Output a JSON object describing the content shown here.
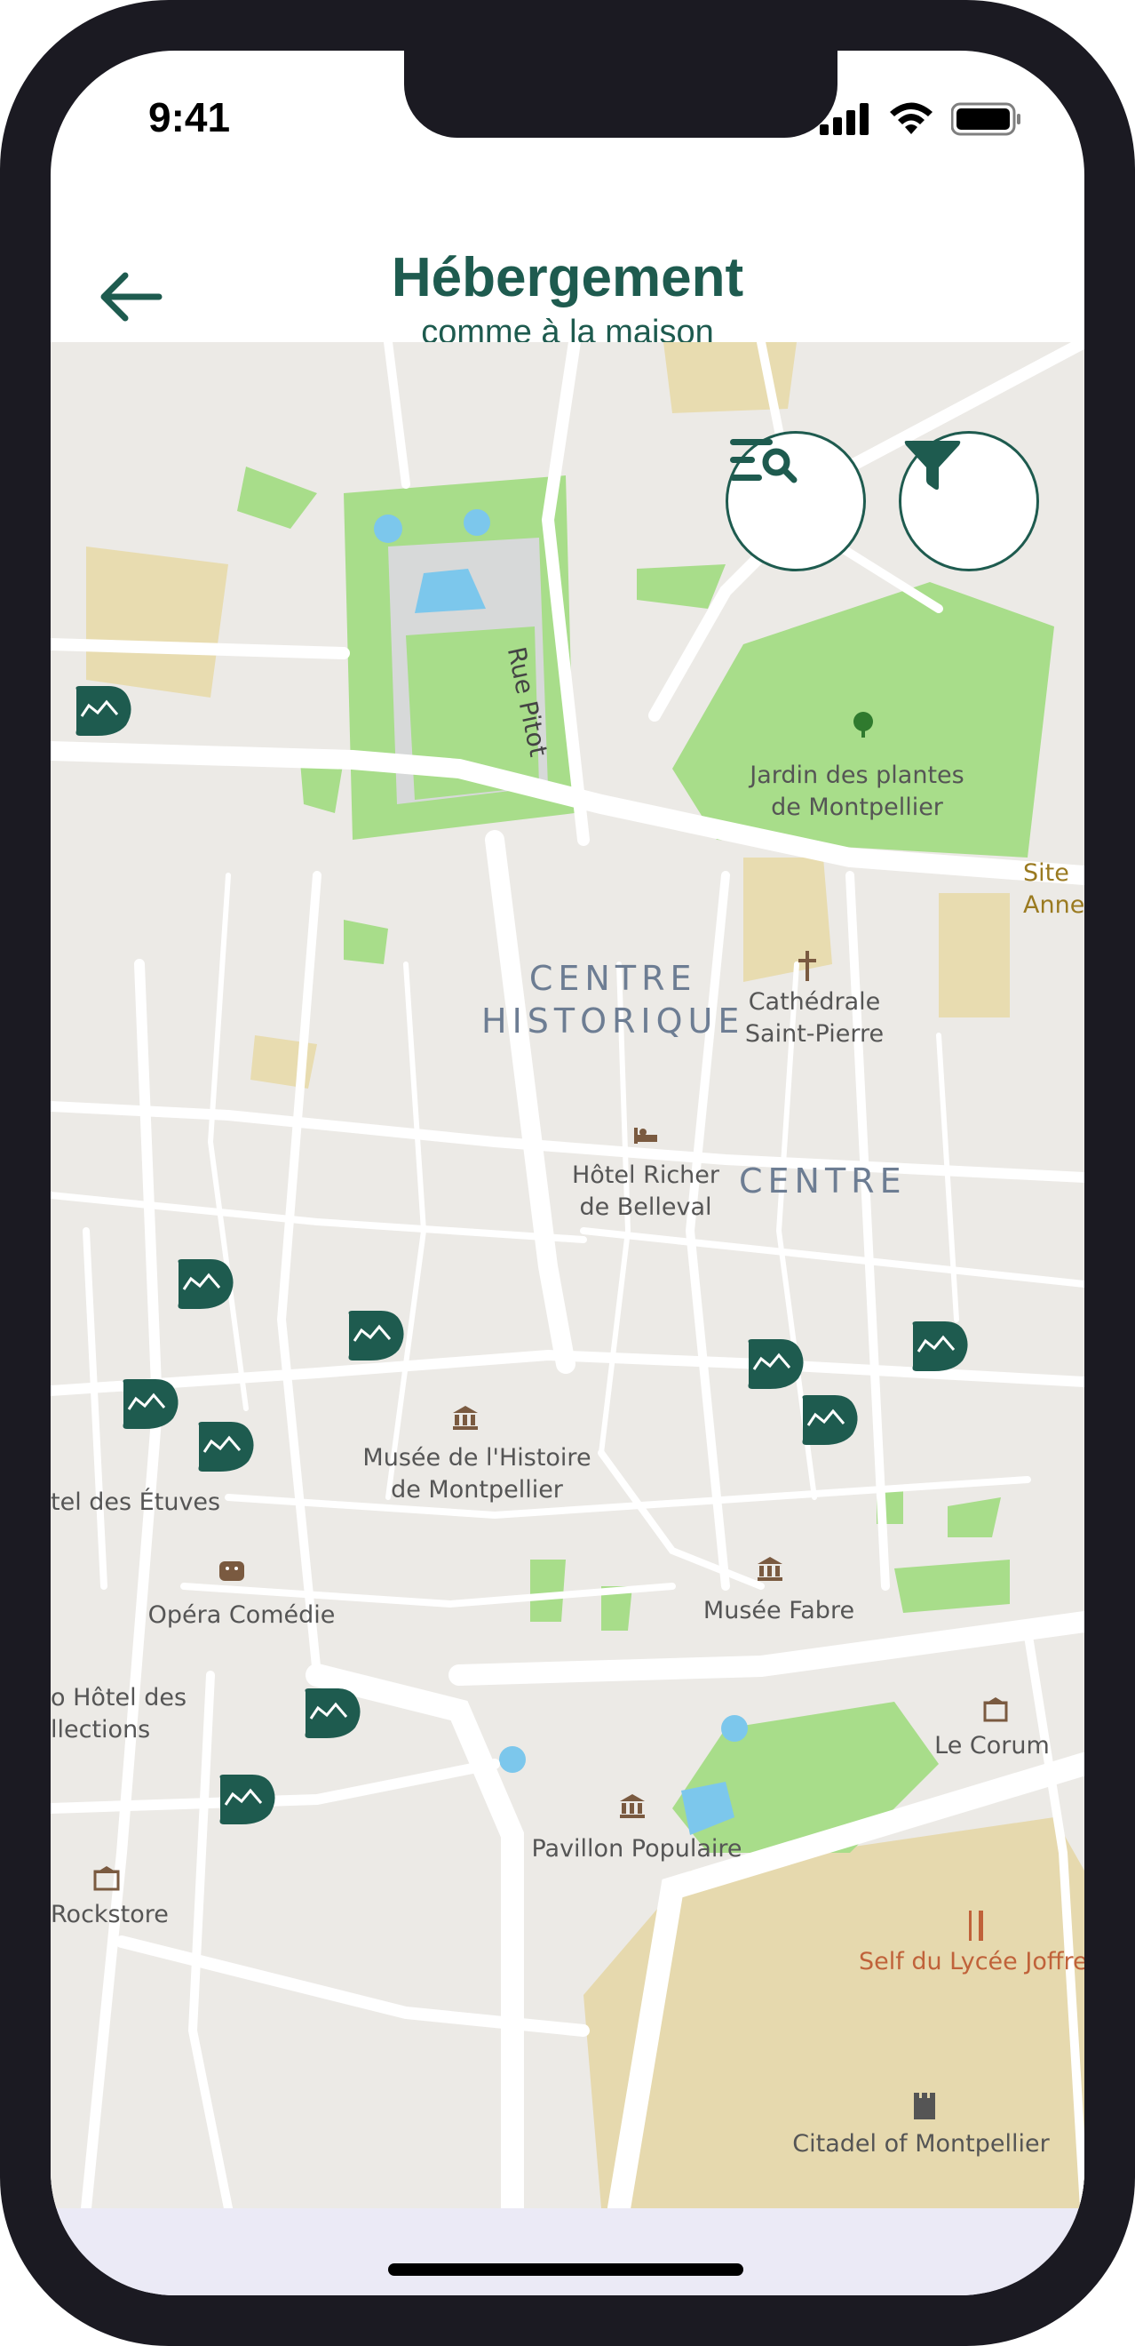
{
  "status": {
    "time": "9:41"
  },
  "header": {
    "title": "Hébergement",
    "subtitle": "comme à la maison"
  },
  "icons": {
    "back": "arrow-left-icon",
    "search_list": "list-search-icon",
    "filter": "filter-icon",
    "marker": "accommodation-marker-icon"
  },
  "colors": {
    "brand": "#1e5b4f",
    "park": "#a8dd8a",
    "water": "#7cc7ec"
  },
  "map": {
    "streets": [
      "Rue Pitot"
    ],
    "districts": [
      "CENTRE\nHISTORIQUE",
      "CENTRE"
    ],
    "places": [
      "Jardin des plantes\nde Montpellier",
      "Site\nAnne",
      "Cathédrale\nSaint-Pierre",
      "Hôtel Richer\nde Belleval",
      "Musée de l'Histoire\nde Montpellier",
      "tel des Étuves",
      "Opéra Comédie",
      "Musée Fabre",
      "o Hôtel des\nllections",
      "Le Corum",
      "Pavillon Populaire",
      "Rockstore",
      "Self du Lycée Joffre",
      "Citadel of Montpellier"
    ]
  }
}
